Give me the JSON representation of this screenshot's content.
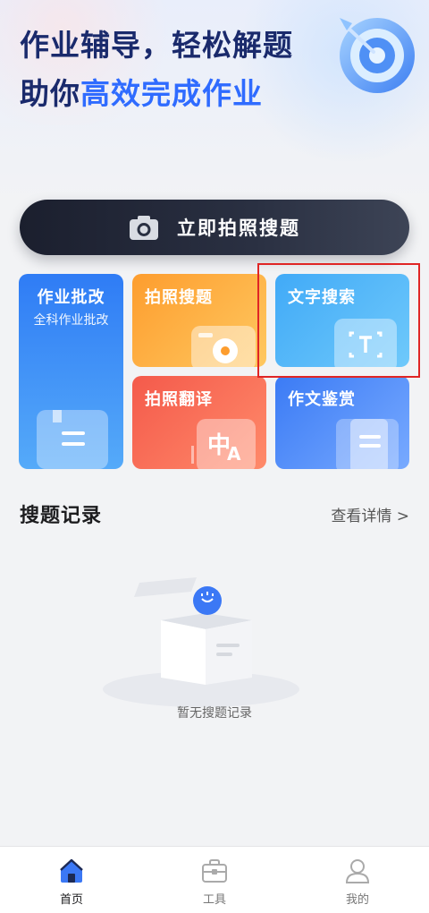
{
  "hero": {
    "line1": "作业辅导，轻松解题",
    "line2_prefix": "助你",
    "line2_accent": "高效完成作业",
    "illustration_icon": "target-dart-icon"
  },
  "scan_button": {
    "label": "立即拍照搜题",
    "icon": "camera-icon"
  },
  "features": {
    "homework_check": {
      "title": "作业批改",
      "subtitle": "全科作业批改",
      "icon": "book-icon",
      "color": "#2f7cf5"
    },
    "photo_search": {
      "title": "拍照搜题",
      "icon": "camera-icon",
      "color": "#fd9d2e"
    },
    "text_search": {
      "title": "文字搜索",
      "icon": "text-scan-icon",
      "color": "#41aaf7"
    },
    "photo_translate": {
      "title": "拍照翻译",
      "icon": "translate-icon",
      "color": "#f45a4b"
    },
    "essay_review": {
      "title": "作文鉴赏",
      "icon": "document-icon",
      "color": "#3b7bf5"
    }
  },
  "records": {
    "title": "搜题记录",
    "more": "查看详情 >",
    "empty_text": "暂无搜题记录"
  },
  "tabbar": {
    "home": "首页",
    "tools": "工具",
    "mine": "我的"
  },
  "colors": {
    "accent": "#2f6bff",
    "headline": "#1a2a6c",
    "highlight_box": "#e02525"
  }
}
